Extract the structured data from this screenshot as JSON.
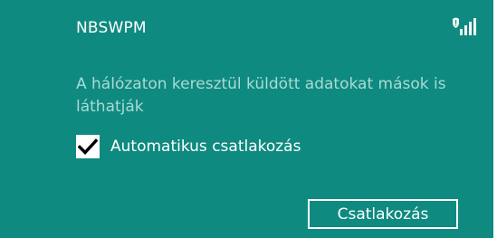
{
  "network": {
    "name": "NBSWPM",
    "signal_icon": "wifi-signal-warning-icon",
    "warning_text": "A hálózaton keresztül küldött adatokat mások is láthatják"
  },
  "options": {
    "auto_connect_label": "Automatikus csatlakozás",
    "auto_connect_checked": true
  },
  "actions": {
    "connect_label": "Csatlakozás"
  },
  "colors": {
    "panel_background": "#0f8a80",
    "primary_text": "#ffffff",
    "secondary_text": "#a9dbd4"
  }
}
